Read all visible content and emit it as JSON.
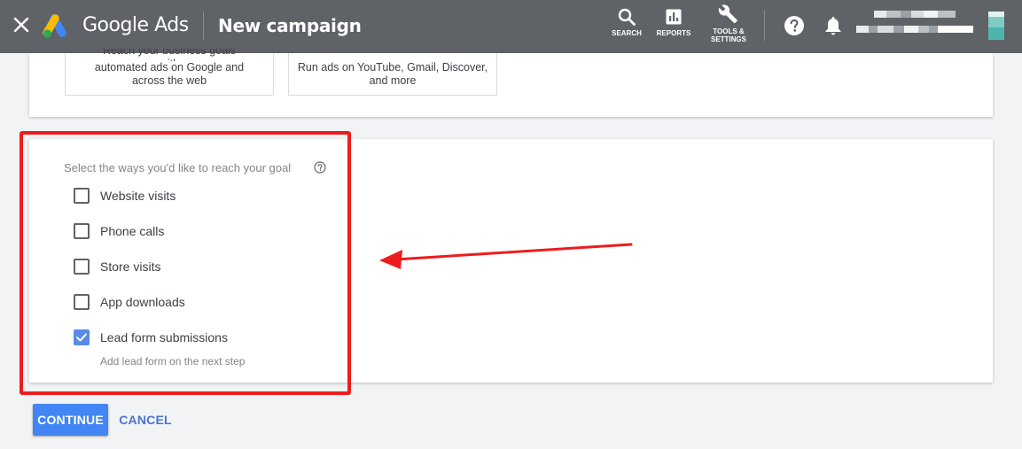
{
  "header": {
    "brand": "Google Ads",
    "page_title": "New campaign",
    "tools": [
      {
        "label": "SEARCH",
        "icon": "search-icon"
      },
      {
        "label": "REPORTS",
        "icon": "reports-icon"
      },
      {
        "label_line1": "TOOLS &",
        "label_line2": "SETTINGS",
        "icon": "wrench-icon"
      }
    ],
    "help_icon": "help-icon",
    "notifications_icon": "bell-icon",
    "background_color": "#5f6368"
  },
  "top_card": {
    "option_one_text": "Reach your business goals with automated ads on Google and across the web",
    "option_one_visible_line1": "Reach your business goals with",
    "option_one_visible_line2": "automated ads on Google and",
    "option_one_visible_line3": "across the web",
    "option_two_visible_line1": "Run ads on YouTube, Gmail, Discover,",
    "option_two_visible_line2": "and more"
  },
  "goal_section": {
    "prompt": "Select the ways you'd like to reach your goal",
    "options": [
      {
        "label": "Website visits",
        "checked": false
      },
      {
        "label": "Phone calls",
        "checked": false
      },
      {
        "label": "Store visits",
        "checked": false
      },
      {
        "label": "App downloads",
        "checked": false
      },
      {
        "label": "Lead form submissions",
        "checked": true
      }
    ],
    "helper_text": "Add lead form on the next step",
    "checkbox_checked_color": "#5b8be6"
  },
  "actions": {
    "continue_label": "CONTINUE",
    "cancel_label": "CANCEL",
    "primary_color": "#4285f4"
  },
  "annotation": {
    "color": "#ee1c1c"
  }
}
